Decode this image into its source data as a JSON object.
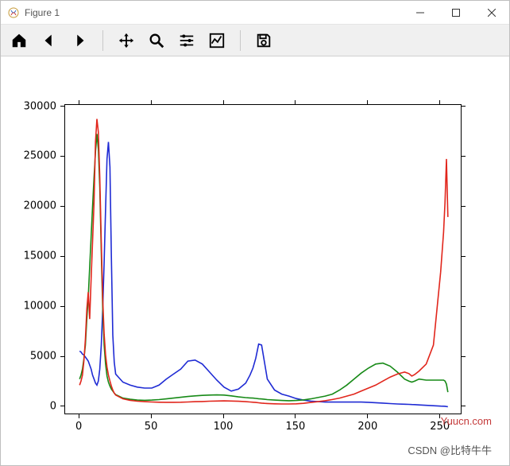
{
  "window": {
    "title": "Figure 1"
  },
  "toolbar": {
    "home": "Home",
    "back": "Back",
    "forward": "Forward",
    "pan": "Pan",
    "zoom": "Zoom",
    "configure": "Configure subplots",
    "edit": "Edit axis",
    "save": "Save"
  },
  "watermarks": {
    "yuucn": "Yuucn.com",
    "csdn": "CSDN @比特牛牛"
  },
  "chart_data": {
    "type": "line",
    "xlabel": "",
    "ylabel": "",
    "title": "",
    "xlim": [
      -10,
      265
    ],
    "ylim": [
      -800,
      30200
    ],
    "xticks": [
      0,
      50,
      100,
      150,
      200,
      250
    ],
    "yticks": [
      0,
      5000,
      10000,
      15000,
      20000,
      25000,
      30000
    ],
    "x": [
      0,
      1,
      2,
      3,
      4,
      5,
      6,
      7,
      8,
      9,
      10,
      11,
      12,
      13,
      14,
      15,
      16,
      17,
      18,
      19,
      20,
      21,
      22,
      23,
      24,
      25,
      30,
      35,
      40,
      45,
      50,
      55,
      60,
      65,
      70,
      75,
      80,
      85,
      90,
      95,
      100,
      105,
      110,
      115,
      118,
      120,
      122,
      124,
      126,
      128,
      130,
      135,
      140,
      145,
      150,
      155,
      160,
      165,
      170,
      175,
      180,
      185,
      190,
      195,
      200,
      205,
      210,
      215,
      220,
      225,
      228,
      230,
      232,
      235,
      240,
      245,
      250,
      252,
      253,
      254,
      255
    ],
    "series": [
      {
        "name": "blue",
        "color": "#1f2bd4",
        "values": [
          5600,
          5500,
          5300,
          5200,
          5000,
          4800,
          4600,
          4200,
          3800,
          3200,
          2800,
          2400,
          2200,
          2600,
          3800,
          6200,
          9800,
          14500,
          19800,
          24800,
          26500,
          24000,
          15000,
          7200,
          4500,
          3300,
          2500,
          2200,
          2000,
          1900,
          1900,
          2200,
          2800,
          3300,
          3800,
          4600,
          4700,
          4300,
          3500,
          2700,
          2000,
          1600,
          1800,
          2400,
          3200,
          3900,
          4900,
          6300,
          6200,
          4500,
          2800,
          1700,
          1300,
          1100,
          850,
          700,
          600,
          550,
          500,
          500,
          500,
          500,
          500,
          500,
          480,
          440,
          400,
          350,
          310,
          290,
          270,
          260,
          250,
          220,
          180,
          140,
          100,
          90,
          80,
          60,
          40
        ]
      },
      {
        "name": "green",
        "color": "#178a17",
        "values": [
          2800,
          3200,
          3800,
          4800,
          6200,
          8800,
          11000,
          14000,
          17000,
          20000,
          23000,
          25500,
          27300,
          25800,
          22000,
          15500,
          9800,
          6200,
          4300,
          3100,
          2500,
          2100,
          1800,
          1600,
          1400,
          1250,
          900,
          780,
          700,
          680,
          700,
          750,
          820,
          900,
          980,
          1060,
          1120,
          1170,
          1200,
          1220,
          1200,
          1120,
          1020,
          950,
          920,
          900,
          870,
          840,
          810,
          780,
          750,
          700,
          660,
          640,
          660,
          720,
          820,
          960,
          1100,
          1300,
          1700,
          2200,
          2800,
          3400,
          3900,
          4300,
          4400,
          4100,
          3500,
          2800,
          2600,
          2500,
          2600,
          2800,
          2700,
          2700,
          2700,
          2700,
          2600,
          2300,
          1500
        ]
      },
      {
        "name": "red",
        "color": "#e1261c",
        "values": [
          2200,
          2600,
          3200,
          4600,
          6800,
          9800,
          11500,
          8800,
          12800,
          16500,
          20500,
          26500,
          28800,
          27500,
          23000,
          16500,
          10800,
          7300,
          5200,
          4000,
          3200,
          2600,
          2100,
          1700,
          1400,
          1200,
          830,
          680,
          590,
          540,
          510,
          490,
          480,
          480,
          490,
          510,
          540,
          560,
          590,
          610,
          620,
          610,
          580,
          540,
          510,
          490,
          460,
          430,
          400,
          380,
          360,
          330,
          310,
          310,
          330,
          380,
          460,
          540,
          640,
          760,
          900,
          1100,
          1300,
          1600,
          1900,
          2200,
          2600,
          3000,
          3300,
          3500,
          3350,
          3100,
          3250,
          3600,
          4300,
          6200,
          13500,
          17500,
          20500,
          24800,
          19000
        ]
      }
    ]
  }
}
